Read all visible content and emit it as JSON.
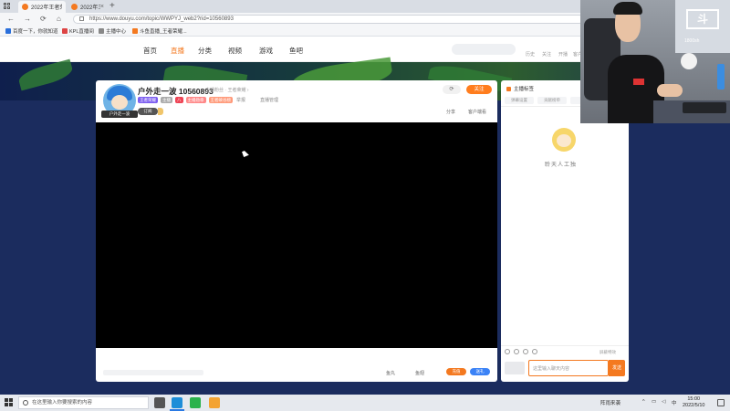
{
  "browser": {
    "tab_active_title": "2022年王者荣耀五五开黑节",
    "tab_second_title": "2022年王者荣耀五五开黑节",
    "new_tab_symbol": "+",
    "close_symbol": "×",
    "url": "https://www.douyu.com/topic/WWPYJ_web2?rid=10560893",
    "bookmarks": [
      "百度一下，你就知道",
      "KPL直播间",
      "主播中心",
      "斗鱼直播_王者荣耀..."
    ]
  },
  "site_nav": {
    "items": [
      "首页",
      "直播",
      "分类",
      "视频",
      "游戏",
      "鱼吧"
    ],
    "active": "直播",
    "right_links": [
      "历史",
      "关注",
      "开播",
      "客户"
    ]
  },
  "room": {
    "streamer_name": "户外走一波",
    "room_id": "10560893",
    "subtitle": "主播粉丝 · 王者荣耀 ›",
    "avatar_label": "户外走一波",
    "badge_labels": [
      "王者荣耀",
      "主播",
      "八",
      "主播勋章",
      "王者峡谷榜"
    ],
    "stat_report": "举报",
    "stat_more": "直播管理",
    "refresh_symbol": "⟳",
    "follow_label": "关注",
    "share_label": "分享",
    "client_label": "客户端看",
    "pill_label": "订阅",
    "bottom": {
      "ctl_left": "鱼丸",
      "ctl_right": "鱼翅",
      "gift_a": "充值",
      "gift_b": "送礼"
    }
  },
  "chat": {
    "header": "主播标签",
    "tabs": [
      "弹幕设置",
      "贡献榜单",
      "贵宾"
    ],
    "mascot_text": "聆天人工独",
    "lock_label": "屏蔽特效",
    "input_placeholder": "这里输入聊天内容",
    "send_label": "发送"
  },
  "cam": {
    "monitor_logo": "斗",
    "monitor_text": "1800sh"
  },
  "taskbar": {
    "search_placeholder": "在这里输入你要搜索的内容",
    "weather": "阵雨来袭",
    "ime": "中",
    "time": "15:00",
    "date": "2022/5/10"
  },
  "colors": {
    "brand_orange": "#f47920",
    "page_bg": "#1b2c5e",
    "video_bg": "#000000"
  }
}
